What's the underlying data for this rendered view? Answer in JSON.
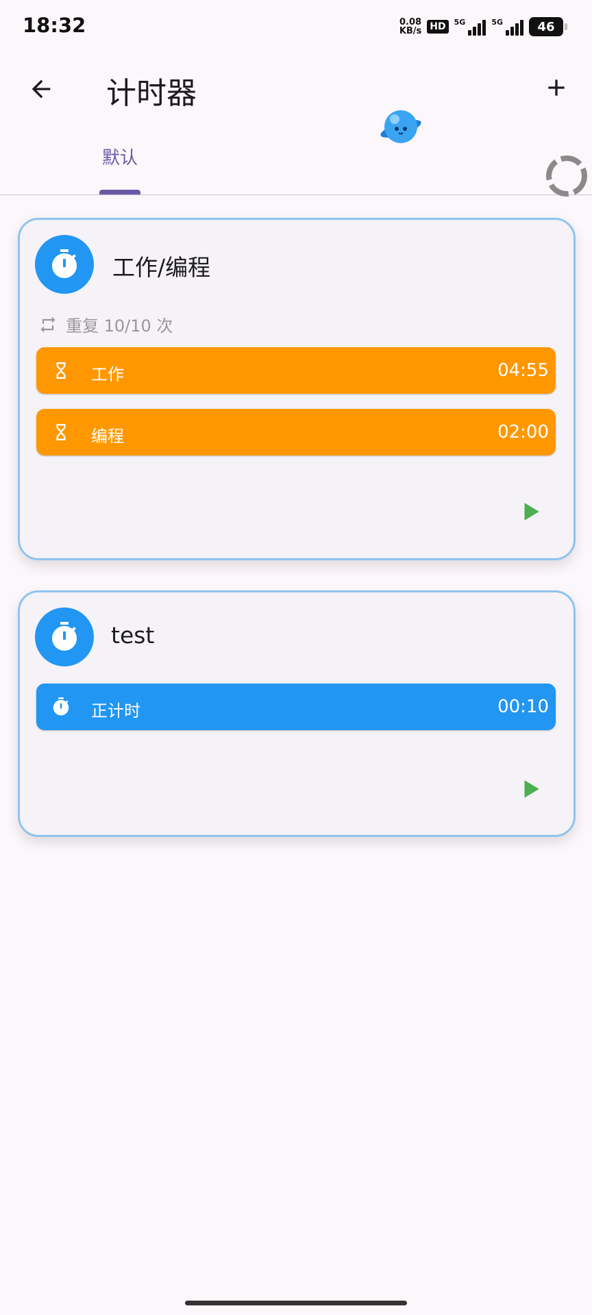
{
  "status_bar": {
    "time": "18:32",
    "net_speed_value": "0.08",
    "net_speed_unit": "KB/s",
    "hd_badge": "HD",
    "signal_label": "5G",
    "battery": "46"
  },
  "app_bar": {
    "title": "计时器",
    "back_icon": "arrow-back-icon",
    "add_icon": "plus-icon"
  },
  "tabs": [
    {
      "label": "默认",
      "selected": true
    }
  ],
  "cards": [
    {
      "title": "工作/编程",
      "repeat_text": "重复 10/10 次",
      "steps": [
        {
          "icon": "hourglass-icon",
          "label": "工作",
          "time": "04:55",
          "color": "#ff9800"
        },
        {
          "icon": "hourglass-icon",
          "label": "编程",
          "time": "02:00",
          "color": "#ff9800"
        }
      ]
    },
    {
      "title": "test",
      "steps": [
        {
          "icon": "stopwatch-icon",
          "label": "正计时",
          "time": "00:10",
          "color": "#2196f3"
        }
      ]
    }
  ],
  "colors": {
    "accent": "#6a5aa6",
    "card_border": "#8ec4ef",
    "timer_blue": "#2196f3",
    "timer_orange": "#ff9800",
    "play_green": "#4caf50"
  }
}
